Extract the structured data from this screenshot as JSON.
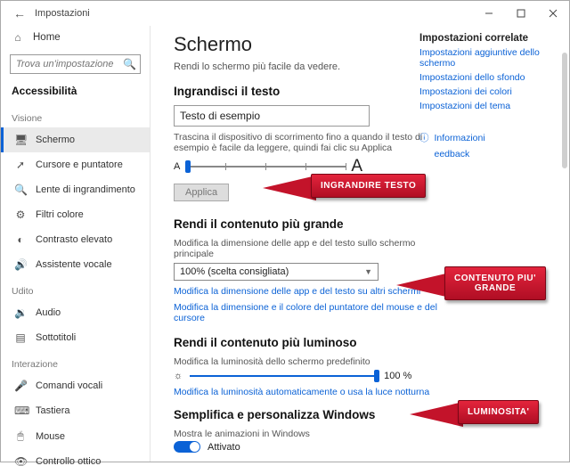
{
  "window": {
    "back_tooltip": "Back",
    "title": "Impostazioni"
  },
  "sidebar": {
    "home": "Home",
    "search_placeholder": "Trova un'impostazione",
    "active": "Accessibilità",
    "groups": [
      {
        "label": "Visione",
        "items": [
          {
            "icon": "display",
            "label": "Schermo",
            "selected": true
          },
          {
            "icon": "cursor",
            "label": "Cursore e puntatore"
          },
          {
            "icon": "magnifier",
            "label": "Lente di ingrandimento"
          },
          {
            "icon": "filter",
            "label": "Filtri colore"
          },
          {
            "icon": "contrast",
            "label": "Contrasto elevato"
          },
          {
            "icon": "narrator",
            "label": "Assistente vocale"
          }
        ]
      },
      {
        "label": "Udito",
        "items": [
          {
            "icon": "audio",
            "label": "Audio"
          },
          {
            "icon": "caption",
            "label": "Sottotitoli"
          }
        ]
      },
      {
        "label": "Interazione",
        "items": [
          {
            "icon": "voice",
            "label": "Comandi vocali"
          },
          {
            "icon": "keyboard",
            "label": "Tastiera"
          },
          {
            "icon": "mouse",
            "label": "Mouse"
          },
          {
            "icon": "eye",
            "label": "Controllo ottico"
          }
        ]
      }
    ]
  },
  "page": {
    "title": "Schermo",
    "subtitle": "Rendi lo schermo più facile da vedere.",
    "s1": {
      "heading": "Ingrandisci il testo",
      "sample": "Testo di esempio",
      "hint": "Trascina il dispositivo di scorrimento fino a quando il testo di esempio è facile da leggere, quindi fai clic su Applica",
      "small_a": "A",
      "big_a": "A",
      "apply": "Applica"
    },
    "s2": {
      "heading": "Rendi il contenuto più grande",
      "hint": "Modifica la dimensione delle app e del testo sullo schermo principale",
      "select": "100% (scelta consigliata)",
      "link1": "Modifica la dimensione delle app e del testo su altri schermi",
      "link2": "Modifica la dimensione e il colore del puntatore del mouse e del cursore"
    },
    "s3": {
      "heading": "Rendi il contenuto più luminoso",
      "hint": "Modifica la luminosità dello schermo predefinito",
      "value": "100 %",
      "link": "Modifica la luminosità automaticamente o usa la luce notturna"
    },
    "s4": {
      "heading": "Semplifica e personalizza Windows",
      "opt": "Mostra le animazioni in Windows",
      "state": "Attivato"
    }
  },
  "related": {
    "heading": "Impostazioni correlate",
    "links": [
      "Impostazioni aggiuntive dello schermo",
      "Impostazioni dello sfondo",
      "Impostazioni dei colori",
      "Impostazioni del tema"
    ],
    "info": "Informazioni",
    "feedback": "eedback"
  },
  "callouts": {
    "c1": "INGRANDIRE TESTO",
    "c2a": "CONTENUTO PIU'",
    "c2b": "GRANDE",
    "c3": "LUMINOSITA'"
  }
}
